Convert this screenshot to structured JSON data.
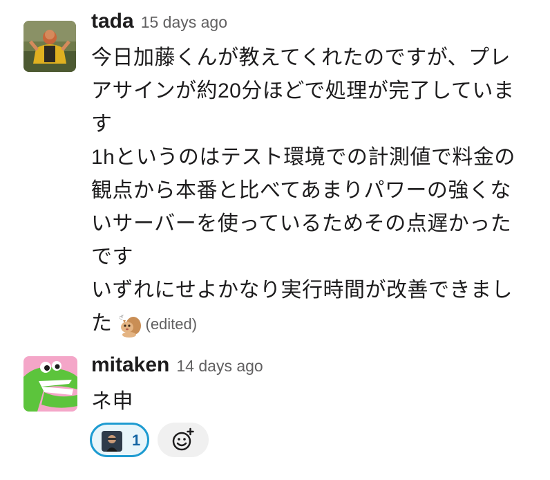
{
  "messages": [
    {
      "username": "tada",
      "timestamp": "15 days ago",
      "lines": [
        "今日加藤くんが教えてくれたのですが、プレ",
        "アサインが約20分ほどで処理が完了していま",
        "す",
        "1hというのはテスト環境での計測値で料金の",
        "観点から本番と比べてあまりパワーの強くな",
        "いサーバーを使っているためその点遅かった",
        "です",
        "いずれにせよかなり実行時間が改善できまし"
      ],
      "last_line_text": "た",
      "inline_emoji": "squirrel-emoji",
      "edited_label": "(edited)"
    },
    {
      "username": "mitaken",
      "timestamp": "14 days ago",
      "lines": [
        "ネ申"
      ],
      "reactions": [
        {
          "emoji": "person-photo-emoji",
          "count": "1",
          "selected": true
        }
      ],
      "add_reaction_icon": "add-emoji-icon"
    }
  ],
  "colors": {
    "text": "#1d1c1d",
    "muted": "#616061",
    "reaction_border": "#1d9bd1",
    "reaction_bg": "#e8f5fa",
    "reaction_count": "#1264a3"
  }
}
